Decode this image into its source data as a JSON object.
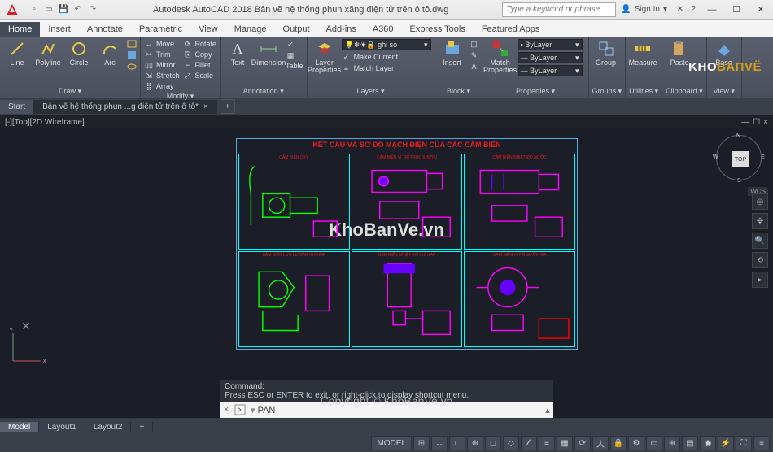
{
  "title": "Autodesk AutoCAD 2018   Bản vẽ hệ thống phun xăng điện tử trên ô tô.dwg",
  "search_placeholder": "Type a keyword or phrase",
  "signin": "Sign In",
  "ribbon_tabs": [
    "Home",
    "Insert",
    "Annotate",
    "Parametric",
    "View",
    "Manage",
    "Output",
    "Add-ins",
    "A360",
    "Express Tools",
    "Featured Apps"
  ],
  "panels": {
    "draw": {
      "title": "Draw ▾",
      "items": [
        "Line",
        "Polyline",
        "Circle",
        "Arc"
      ]
    },
    "modify": {
      "title": "Modify ▾",
      "grid": [
        "Move",
        "Rotate",
        "Trim",
        "Copy",
        "Mirror",
        "Fillet",
        "Stretch",
        "Scale",
        "Array"
      ]
    },
    "annotation": {
      "title": "Annotation ▾",
      "items": [
        "Text",
        "Dimension"
      ],
      "table": "Table"
    },
    "layers": {
      "title": "Layers ▾",
      "btn": "Layer\nProperties",
      "combo": "ghi so",
      "items": [
        "Make Current",
        "Match Layer"
      ]
    },
    "block": {
      "title": "Block ▾",
      "btn": "Insert"
    },
    "properties": {
      "title": "Properties ▾",
      "btn": "Match\nProperties",
      "combos": [
        "ByLayer",
        "ByLayer",
        "ByLayer"
      ]
    },
    "groups": {
      "title": "Groups ▾",
      "btn": "Group"
    },
    "utilities": {
      "title": "Utilities ▾",
      "btn": "Measure"
    },
    "clipboard": {
      "title": "Clipboard ▾",
      "btn": "Paste"
    },
    "view": {
      "title": "View ▾",
      "btn": "Base"
    }
  },
  "doc_tabs": {
    "start": "Start",
    "active": "Bản vẽ hệ thống phun ...g điện tử trên ô tô*"
  },
  "viewport_label": "[-][Top][2D Wireframe]",
  "navcube": {
    "top": "TOP",
    "n": "N",
    "s": "S",
    "e": "E",
    "w": "W",
    "wcs": "WCS"
  },
  "drawing_title": "KẾT CẤU VÀ SƠ ĐỒ MẠCH ĐIỆN CỦA CÁC CẢM BIẾN",
  "cell_labels": [
    "CẢM BIẾN OXY",
    "CẢM BIẾN VỊ TRÍ TRỤC KHUỶU",
    "CẢM BIẾN NHIỆT ĐỘ NƯỚC",
    "CẢM BIẾN LƯU LƯỢNG KHÍ NẠP",
    "CẢM BIẾN NHIỆT ĐỘ KHÍ NẠP",
    "CẢM BIẾN VỊ TRÍ BƯỚM GA"
  ],
  "cmd": {
    "label": "Command:",
    "hint": "Press ESC or ENTER to exit, or right-click to display shortcut menu.",
    "current": "PAN"
  },
  "layout_tabs": [
    "Model",
    "Layout1",
    "Layout2"
  ],
  "status": {
    "model": "MODEL"
  },
  "watermark": {
    "brand": "KhoBanVe.vn",
    "copyright": "Copyright © KhoBanVe.vn",
    "logo_a": "KHO",
    "logo_b": "BAПVЁ"
  }
}
